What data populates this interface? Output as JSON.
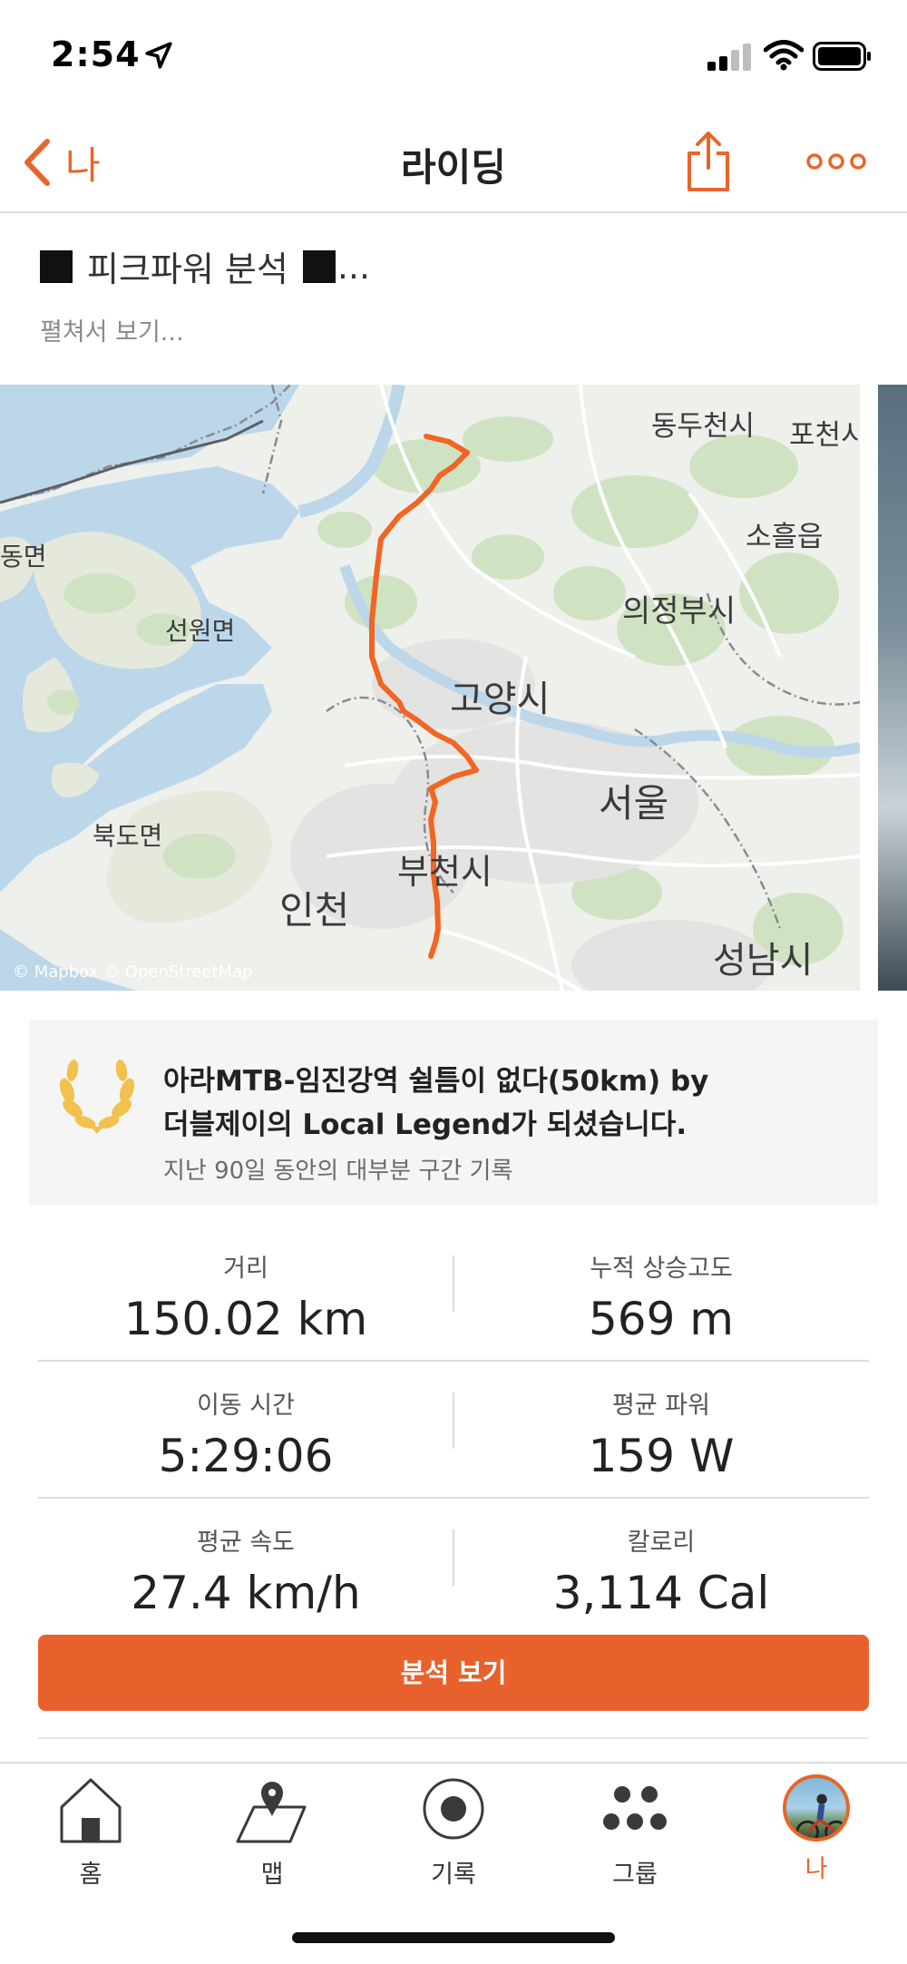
{
  "status_bar": {
    "time": "2:54"
  },
  "nav": {
    "back_label": "나",
    "title": "라이딩"
  },
  "description": {
    "title_text": "피크파워 분석",
    "title_suffix": "...",
    "expand_label": "펼쳐서 보기..."
  },
  "map": {
    "attribution": "© Mapbox © OpenStreetMap",
    "place_labels": [
      "동두천시",
      "포천시",
      "소흘읍",
      "동면",
      "선원면",
      "의정부시",
      "고양시",
      "서울",
      "북도면",
      "부천시",
      "인천",
      "성남시"
    ],
    "route_color": "#f26522"
  },
  "legend": {
    "line1": "아라MTB-임진강역 쉴틈이 없다(50km) by",
    "line2": "더블제이의  Local Legend가 되셨습니다.",
    "subtitle": "지난 90일 동안의 대부분 구간 기록"
  },
  "stats": [
    {
      "left": {
        "label": "거리",
        "value": "150.02 km"
      },
      "right": {
        "label": "누적 상승고도",
        "value": "569 m"
      }
    },
    {
      "left": {
        "label": "이동 시간",
        "value": "5:29:06"
      },
      "right": {
        "label": "평균 파워",
        "value": "159 W"
      }
    },
    {
      "left": {
        "label": "평균 속도",
        "value": "27.4 km/h"
      },
      "right": {
        "label": "칼로리",
        "value": "3,114 Cal"
      }
    }
  ],
  "analyze_button": "분석 보기",
  "tabs": [
    {
      "label": "홈",
      "icon": "home-icon"
    },
    {
      "label": "맵",
      "icon": "map-pin-icon"
    },
    {
      "label": "기록",
      "icon": "record-icon"
    },
    {
      "label": "그룹",
      "icon": "group-icon"
    },
    {
      "label": "나",
      "icon": "avatar",
      "active": true
    }
  ],
  "colors": {
    "accent": "#e8652a",
    "button": "#e8612c"
  }
}
